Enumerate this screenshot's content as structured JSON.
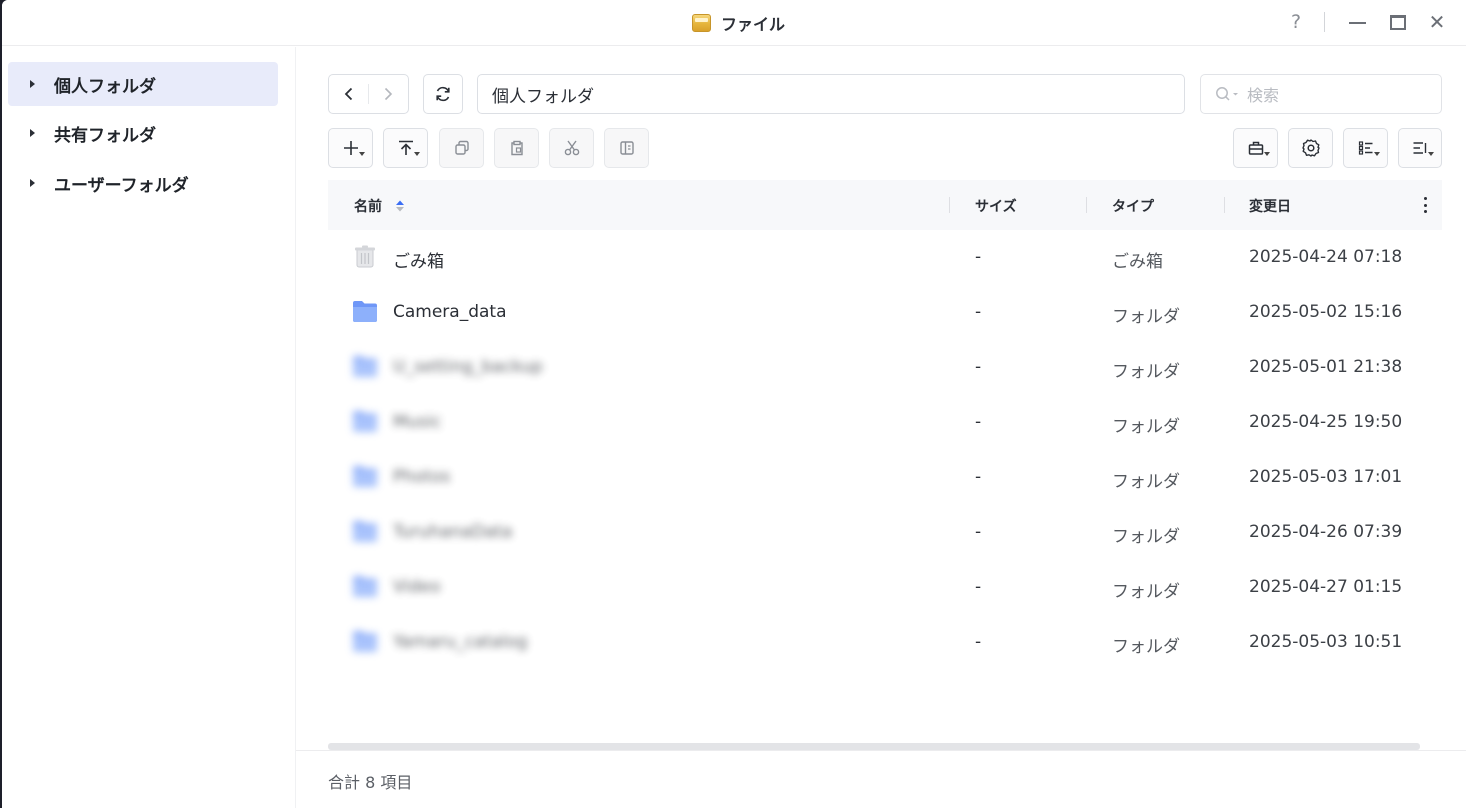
{
  "window": {
    "title": "ファイル",
    "help_label": "?",
    "close_label": "✕"
  },
  "sidebar": {
    "items": [
      {
        "label": "個人フォルダ",
        "active": true
      },
      {
        "label": "共有フォルダ",
        "active": false
      },
      {
        "label": "ユーザーフォルダ",
        "active": false
      }
    ]
  },
  "toolbar": {
    "path": "個人フォルダ",
    "search_placeholder": "検索",
    "buttons": [
      "new-icon",
      "upload-icon",
      "copy-icon",
      "paste-icon",
      "cut-icon",
      "move-icon",
      "toolbox-icon",
      "settings-icon",
      "view-mode-icon",
      "sort-menu-icon"
    ]
  },
  "table": {
    "columns": {
      "name": "名前",
      "size": "サイズ",
      "type": "タイプ",
      "modified": "変更日"
    },
    "rows": [
      {
        "name": "ごみ箱",
        "size": "-",
        "type": "ごみ箱",
        "modified": "2025-04-24 07:18",
        "icon": "trash-icon",
        "blurred": false
      },
      {
        "name": "Camera_data",
        "size": "-",
        "type": "フォルダ",
        "modified": "2025-05-02 15:16",
        "icon": "folder-icon",
        "blurred": false
      },
      {
        "name": "U_setting_backup",
        "size": "-",
        "type": "フォルダ",
        "modified": "2025-05-01 21:38",
        "icon": "folder-icon",
        "blurred": true
      },
      {
        "name": "Music",
        "size": "-",
        "type": "フォルダ",
        "modified": "2025-04-25 19:50",
        "icon": "folder-icon",
        "blurred": true
      },
      {
        "name": "Photos",
        "size": "-",
        "type": "フォルダ",
        "modified": "2025-05-03 17:01",
        "icon": "folder-icon",
        "blurred": true
      },
      {
        "name": "TuruhanaData",
        "size": "-",
        "type": "フォルダ",
        "modified": "2025-04-26 07:39",
        "icon": "folder-icon",
        "blurred": true
      },
      {
        "name": "Video",
        "size": "-",
        "type": "フォルダ",
        "modified": "2025-04-27 01:15",
        "icon": "folder-icon",
        "blurred": true
      },
      {
        "name": "Yamaru_catalog",
        "size": "-",
        "type": "フォルダ",
        "modified": "2025-05-03 10:51",
        "icon": "folder-icon",
        "blurred": true
      }
    ]
  },
  "footer": {
    "total": "合計 8 項目"
  }
}
